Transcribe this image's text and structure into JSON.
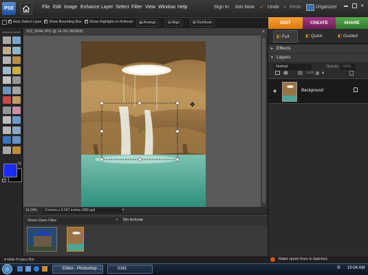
{
  "app": {
    "logo_text": "PSE",
    "menus": [
      "File",
      "Edit",
      "Image",
      "Enhance",
      "Layer",
      "Select",
      "Filter",
      "View",
      "Window",
      "Help"
    ],
    "right_menu": {
      "sign_in": "Sign In",
      "join_now": "Join Now",
      "undo": "Undo",
      "redo": "Redo",
      "organizer": "Organizer"
    }
  },
  "mode_tabs": {
    "edit": "EDIT",
    "create": "CREATE",
    "share": "SHARE"
  },
  "options_bar": {
    "auto_select_layer": "Auto Select Layer",
    "show_bounding_box": "Show Bounding Box",
    "show_highlight": "Show Highlight on Rollover",
    "arrange": "Arrange",
    "align": "Align",
    "distribute": "Distribute"
  },
  "document": {
    "tab_title": "103_0044.JPG @ 14.3% (RGB/8)",
    "zoom": "14.24%",
    "dimensions": "3 inches x 6.667 inches (480 ppi)"
  },
  "edit_subtabs": {
    "full": "Full",
    "quick": "Quick",
    "guided": "Guided"
  },
  "panels": {
    "effects": "Effects",
    "layers": "Layers",
    "blend_mode": "Normal",
    "opacity_label": "Opacity:",
    "opacity_value": "100%",
    "lock_label": "Lock:",
    "layer_name": "Background"
  },
  "bin": {
    "show_open_files": "Show Open Files",
    "bin_actions": "Bin Actions",
    "hide_project_bin": "Hide Project Bin"
  },
  "quick_fix": "Make quick fixes in batches",
  "taskbar": {
    "task1": "Editor - Photoshop ...",
    "task2": "0161",
    "clock": "10:04 AM"
  },
  "colors": {
    "edit_tab": "#e8820e",
    "create_tab": "#8a2a6e",
    "share_tab": "#3f8c3a",
    "foreground_swatch": "#1a2cf0",
    "background_swatch": "#050505"
  }
}
